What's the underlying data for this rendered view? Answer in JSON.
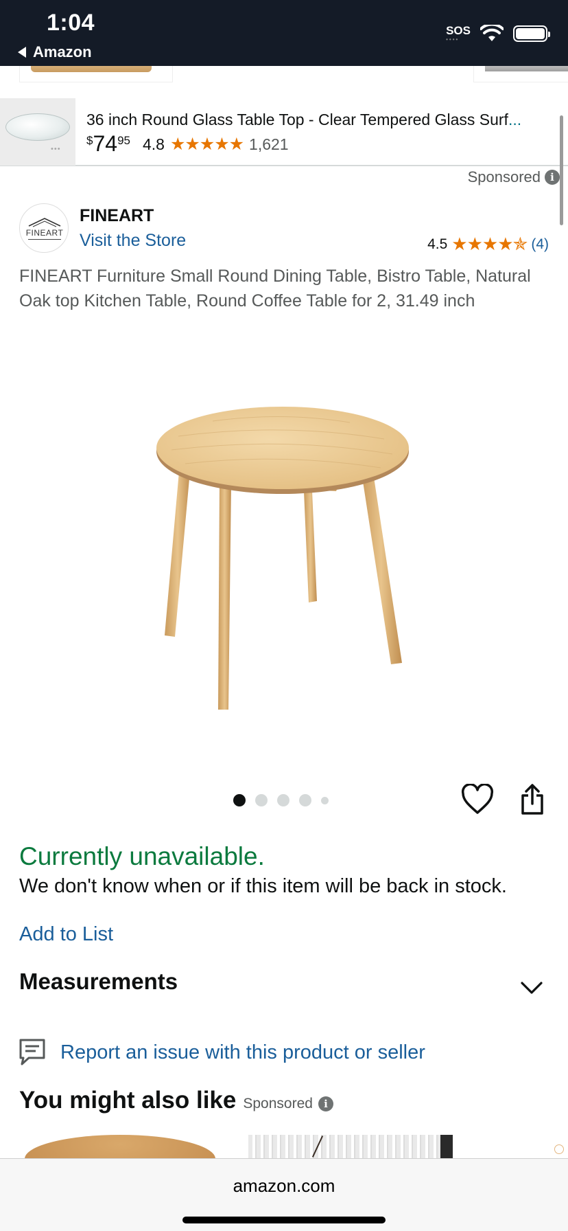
{
  "status_bar": {
    "time": "1:04",
    "back_label": "Amazon",
    "sos": "SOS",
    "icons": [
      "sos-indicator",
      "wifi-icon",
      "battery-icon"
    ]
  },
  "sponsored_banner": {
    "title": "36 inch Round Glass Table Top - Clear Tempered Glass Surf",
    "title_ellipsis": "...",
    "price_currency": "$",
    "price_whole": "74",
    "price_fraction": "95",
    "rating": "4.8",
    "stars": "★★★★★",
    "review_count": "1,621"
  },
  "sponsored_label": "Sponsored",
  "brand": {
    "logo_text": "FINEART",
    "name": "FINEART",
    "visit_store": "Visit the Store",
    "rating": "4.5",
    "stars": "★★★★✯",
    "review_count": "(4)"
  },
  "product": {
    "title": "FINEART Furniture Small Round Dining Table, Bistro Table, Natural Oak top Kitchen Table, Round Coffee Table for 2, 31.49 inch",
    "image_count": 5,
    "active_image": 1
  },
  "availability": {
    "status": "Currently unavailable.",
    "detail": "We don't know when or if this item will be back in stock."
  },
  "actions": {
    "add_to_list": "Add to List",
    "measurements": "Measurements",
    "report": "Report an issue with this product or seller"
  },
  "recommendations": {
    "heading": "You might also like",
    "sponsored": "Sponsored"
  },
  "browser": {
    "url": "amazon.com"
  },
  "colors": {
    "status_bar_bg": "#141b27",
    "link_blue": "#1a5e9a",
    "unavailable_green": "#0b7a3e",
    "star_orange": "#e77600"
  }
}
